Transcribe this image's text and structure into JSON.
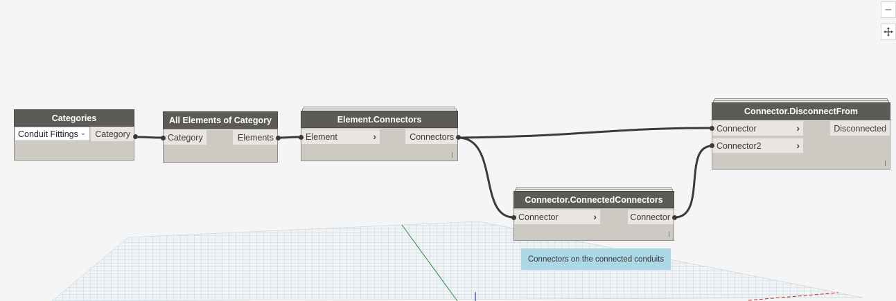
{
  "nodes": {
    "categories": {
      "title": "Categories",
      "dropdown_value": "Conduit Fittings",
      "output": "Category"
    },
    "all_elements": {
      "title": "All Elements of Category",
      "input": "Category",
      "output": "Elements"
    },
    "element_connectors": {
      "title": "Element.Connectors",
      "input": "Element",
      "output": "Connectors"
    },
    "connected_connectors": {
      "title": "Connector.ConnectedConnectors",
      "input": "Connector",
      "output": "Connector"
    },
    "disconnect_from": {
      "title": "Connector.DisconnectFrom",
      "inputs": [
        "Connector",
        "Connector2"
      ],
      "output": "Disconnected"
    }
  },
  "note": "Connectors on the connected conduits",
  "icons": {
    "zoom_out": "minus-icon",
    "pan": "move-icon",
    "port_arrow": "chevron-right-icon",
    "dropdown": "chevron-down-icon"
  },
  "colors": {
    "node_header": "#5d5b57",
    "node_body": "#cdc9c3",
    "note_bg": "#add8e6",
    "wire": "#3a3a3a"
  }
}
